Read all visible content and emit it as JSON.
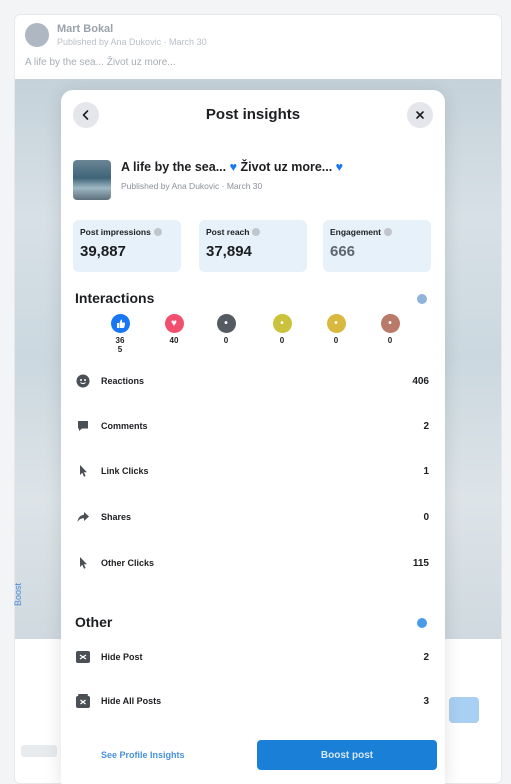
{
  "background_post": {
    "author": "Mart Bokal",
    "meta": "Published by Ana Dukovic · March 30",
    "caption": "A life by the sea... Život uz more...",
    "side_tag": "Boost"
  },
  "modal": {
    "title": "Post insights",
    "post": {
      "text": "A life by the sea... ",
      "text2": "Život uz more... ",
      "meta": "Published by Ana Dukovic · March 30"
    },
    "stats": [
      {
        "label": "Post impressions",
        "value": "39,887"
      },
      {
        "label": "Post reach",
        "value": "37,894"
      },
      {
        "label": "Engagement",
        "value": "666"
      }
    ],
    "interactions_title": "Interactions",
    "reactions": [
      {
        "icon": "like-icon",
        "count": "36\n5",
        "color": "#1877f2"
      },
      {
        "icon": "love-icon",
        "count": "40",
        "color": "#f0506e"
      },
      {
        "icon": "care-icon",
        "count": "0",
        "color": "#555b63"
      },
      {
        "icon": "haha-icon",
        "count": "0",
        "color": "#c9c23a"
      },
      {
        "icon": "wow-icon",
        "count": "0",
        "color": "#d9b93d"
      },
      {
        "icon": "sad-icon",
        "count": "0",
        "color": "#b97a6a"
      }
    ],
    "metrics": [
      {
        "icon": "reactions-icon",
        "label": "Reactions",
        "value": "406"
      },
      {
        "icon": "comments-icon",
        "label": "Comments",
        "value": "2"
      },
      {
        "icon": "link-clicks-icon",
        "label": "Link Clicks",
        "value": "1"
      },
      {
        "icon": "shares-icon",
        "label": "Shares",
        "value": "0"
      },
      {
        "icon": "other-clicks-icon",
        "label": "Other Clicks",
        "value": "115"
      }
    ],
    "other_title": "Other",
    "other_metrics": [
      {
        "icon": "hide-post-icon",
        "label": "Hide Post",
        "value": "2"
      },
      {
        "icon": "hide-all-posts-icon",
        "label": "Hide All Posts",
        "value": "3"
      }
    ],
    "footer": {
      "link": "See Profile Insights",
      "button": "Boost post"
    }
  },
  "colors": {
    "accent": "#1877f2",
    "button": "#1a7fd6",
    "stat_card": "#e7f1fa"
  }
}
